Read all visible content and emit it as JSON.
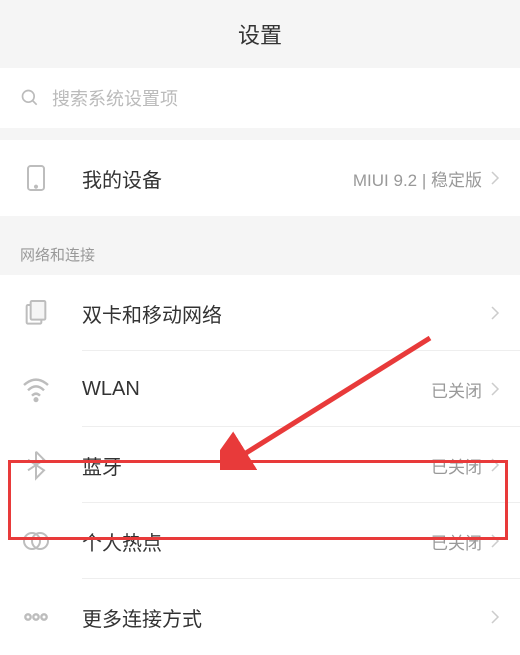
{
  "header": {
    "title": "设置"
  },
  "search": {
    "placeholder": "搜索系统设置项"
  },
  "device": {
    "label": "我的设备",
    "value": "MIUI 9.2 | 稳定版"
  },
  "section_network": {
    "header": "网络和连接",
    "items": [
      {
        "label": "双卡和移动网络",
        "value": ""
      },
      {
        "label": "WLAN",
        "value": "已关闭"
      },
      {
        "label": "蓝牙",
        "value": "已关闭"
      },
      {
        "label": "个人热点",
        "value": "已关闭"
      },
      {
        "label": "更多连接方式",
        "value": ""
      }
    ]
  },
  "colors": {
    "highlight": "#e83a3a",
    "icon_inactive": "#bdbdbd",
    "text_primary": "#333333",
    "text_secondary": "#999999"
  }
}
